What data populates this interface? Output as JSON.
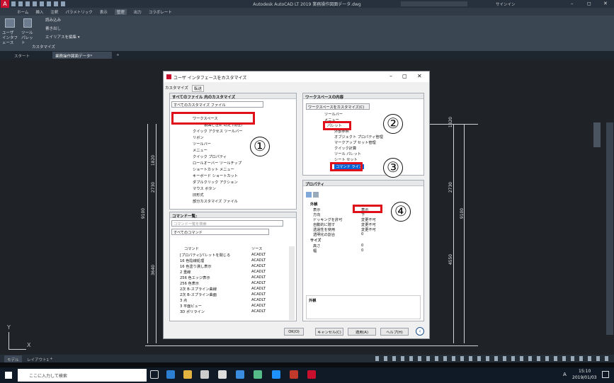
{
  "window": {
    "title": "Autodesk AutoCAD LT 2019   業務操作図面データ.dwg",
    "user": "サインイン"
  },
  "menu": [
    "ホーム",
    "挿入",
    "注釈",
    "パラメトリック",
    "表示",
    "管理",
    "出力",
    "コラボレート"
  ],
  "menu_active": "管理",
  "ribbon": {
    "ui_label": "ユーザ インタフェース",
    "tool_palette_label": "ツール パレット",
    "load_label": "読み込み",
    "export_label": "書き出し",
    "alias_label": "エイリアスを編集 ▾",
    "group_label": "カスタマイズ"
  },
  "file_tabs": {
    "start": "スタート",
    "doc": "業務操作図面データ*"
  },
  "dims_left": [
    "1820",
    "2730",
    "9100",
    "3640"
  ],
  "dims_right": [
    "1820",
    "2730",
    "9100",
    "4550"
  ],
  "dialog": {
    "title": "ユーザ インタフェースをカスタマイズ",
    "tabs": [
      "カスタマイズ",
      "転送"
    ],
    "left_head": "すべてのファイル 内のカスタマイズ",
    "left_combo": "すべてのカスタマイズ ファイル",
    "tree": [
      "ワークスペース",
      "製図と注釈 既定 (現在)",
      "クイック アクセス ツールバー",
      "リボン",
      "ツールバー",
      "メニュー",
      "クイック プロパティ",
      "ロールオーバー ツールチップ",
      "ショートカット メニュー",
      "キーボード ショートカット",
      "ダブルクリック アクション",
      "マウス ボタン",
      "旧形式",
      "部分カスタマイズ ファイル"
    ],
    "cmd_head": "コマンド一覧:",
    "cmd_search_placeholder": "コマンド一覧を検索",
    "cmd_filter": "すべてのコマンド",
    "cmd_cols": [
      "コマンド",
      "ソース"
    ],
    "commands": [
      [
        "[プロパティ]パレットを閉じる",
        "ACADLT"
      ],
      [
        "16 色陰線処理",
        "ACADLT"
      ],
      [
        "16 色塗り潰し表示",
        "ACADLT"
      ],
      [
        "2 重線",
        "ACADLT"
      ],
      [
        "256 色エッジ表示",
        "ACADLT"
      ],
      [
        "256 色表示",
        "ACADLT"
      ],
      [
        "2次 B-スプライン曲線",
        "ACADLT"
      ],
      [
        "2次 B-スプライン曲面",
        "ACADLT"
      ],
      [
        "3 点",
        "ACADLT"
      ],
      [
        "3 平面ビュー",
        "ACADLT"
      ],
      [
        "3D ポリライン",
        "ACADLT"
      ]
    ],
    "ws_head": "ワークスペースの内容",
    "ws_button": "ワークスペースをカスタマイズ(C)",
    "ws_tree": [
      "ツールバー",
      "メニュー",
      "パレット",
      "外部参照",
      "オブジェクト プロパティ管理",
      "マークアップ セット管理",
      "クイック計算",
      "ツール パレット",
      "シート セット",
      "コマンド ライン"
    ],
    "prop_head": "プロパティ",
    "prop_cat1": "外観",
    "props": [
      [
        "表示",
        "表示"
      ],
      [
        "方向",
        "下"
      ],
      [
        "ドッキングを許可",
        "変更不可"
      ],
      [
        "自動的に隠す",
        "変更不可"
      ],
      [
        "透過性を使用",
        "変更不可"
      ],
      [
        "透明化の割合",
        "0"
      ]
    ],
    "prop_cat2": "サイズ",
    "props2": [
      [
        "高さ",
        "0"
      ],
      [
        "幅",
        "0"
      ]
    ],
    "desc_label": "外観",
    "buttons": [
      "OK(O)",
      "キャンセル(C)",
      "適用(A)",
      "ヘルプ(H)"
    ],
    "callouts": [
      "①",
      "②",
      "③",
      "④"
    ]
  },
  "layout_tabs": [
    "モデル",
    "レイアウト1",
    "+"
  ],
  "taskbar": {
    "search": "ここに入力して検索",
    "time": "15:10",
    "date": "2019/01/03",
    "ime": "A"
  },
  "axis": {
    "y": "Y",
    "x": "X"
  }
}
